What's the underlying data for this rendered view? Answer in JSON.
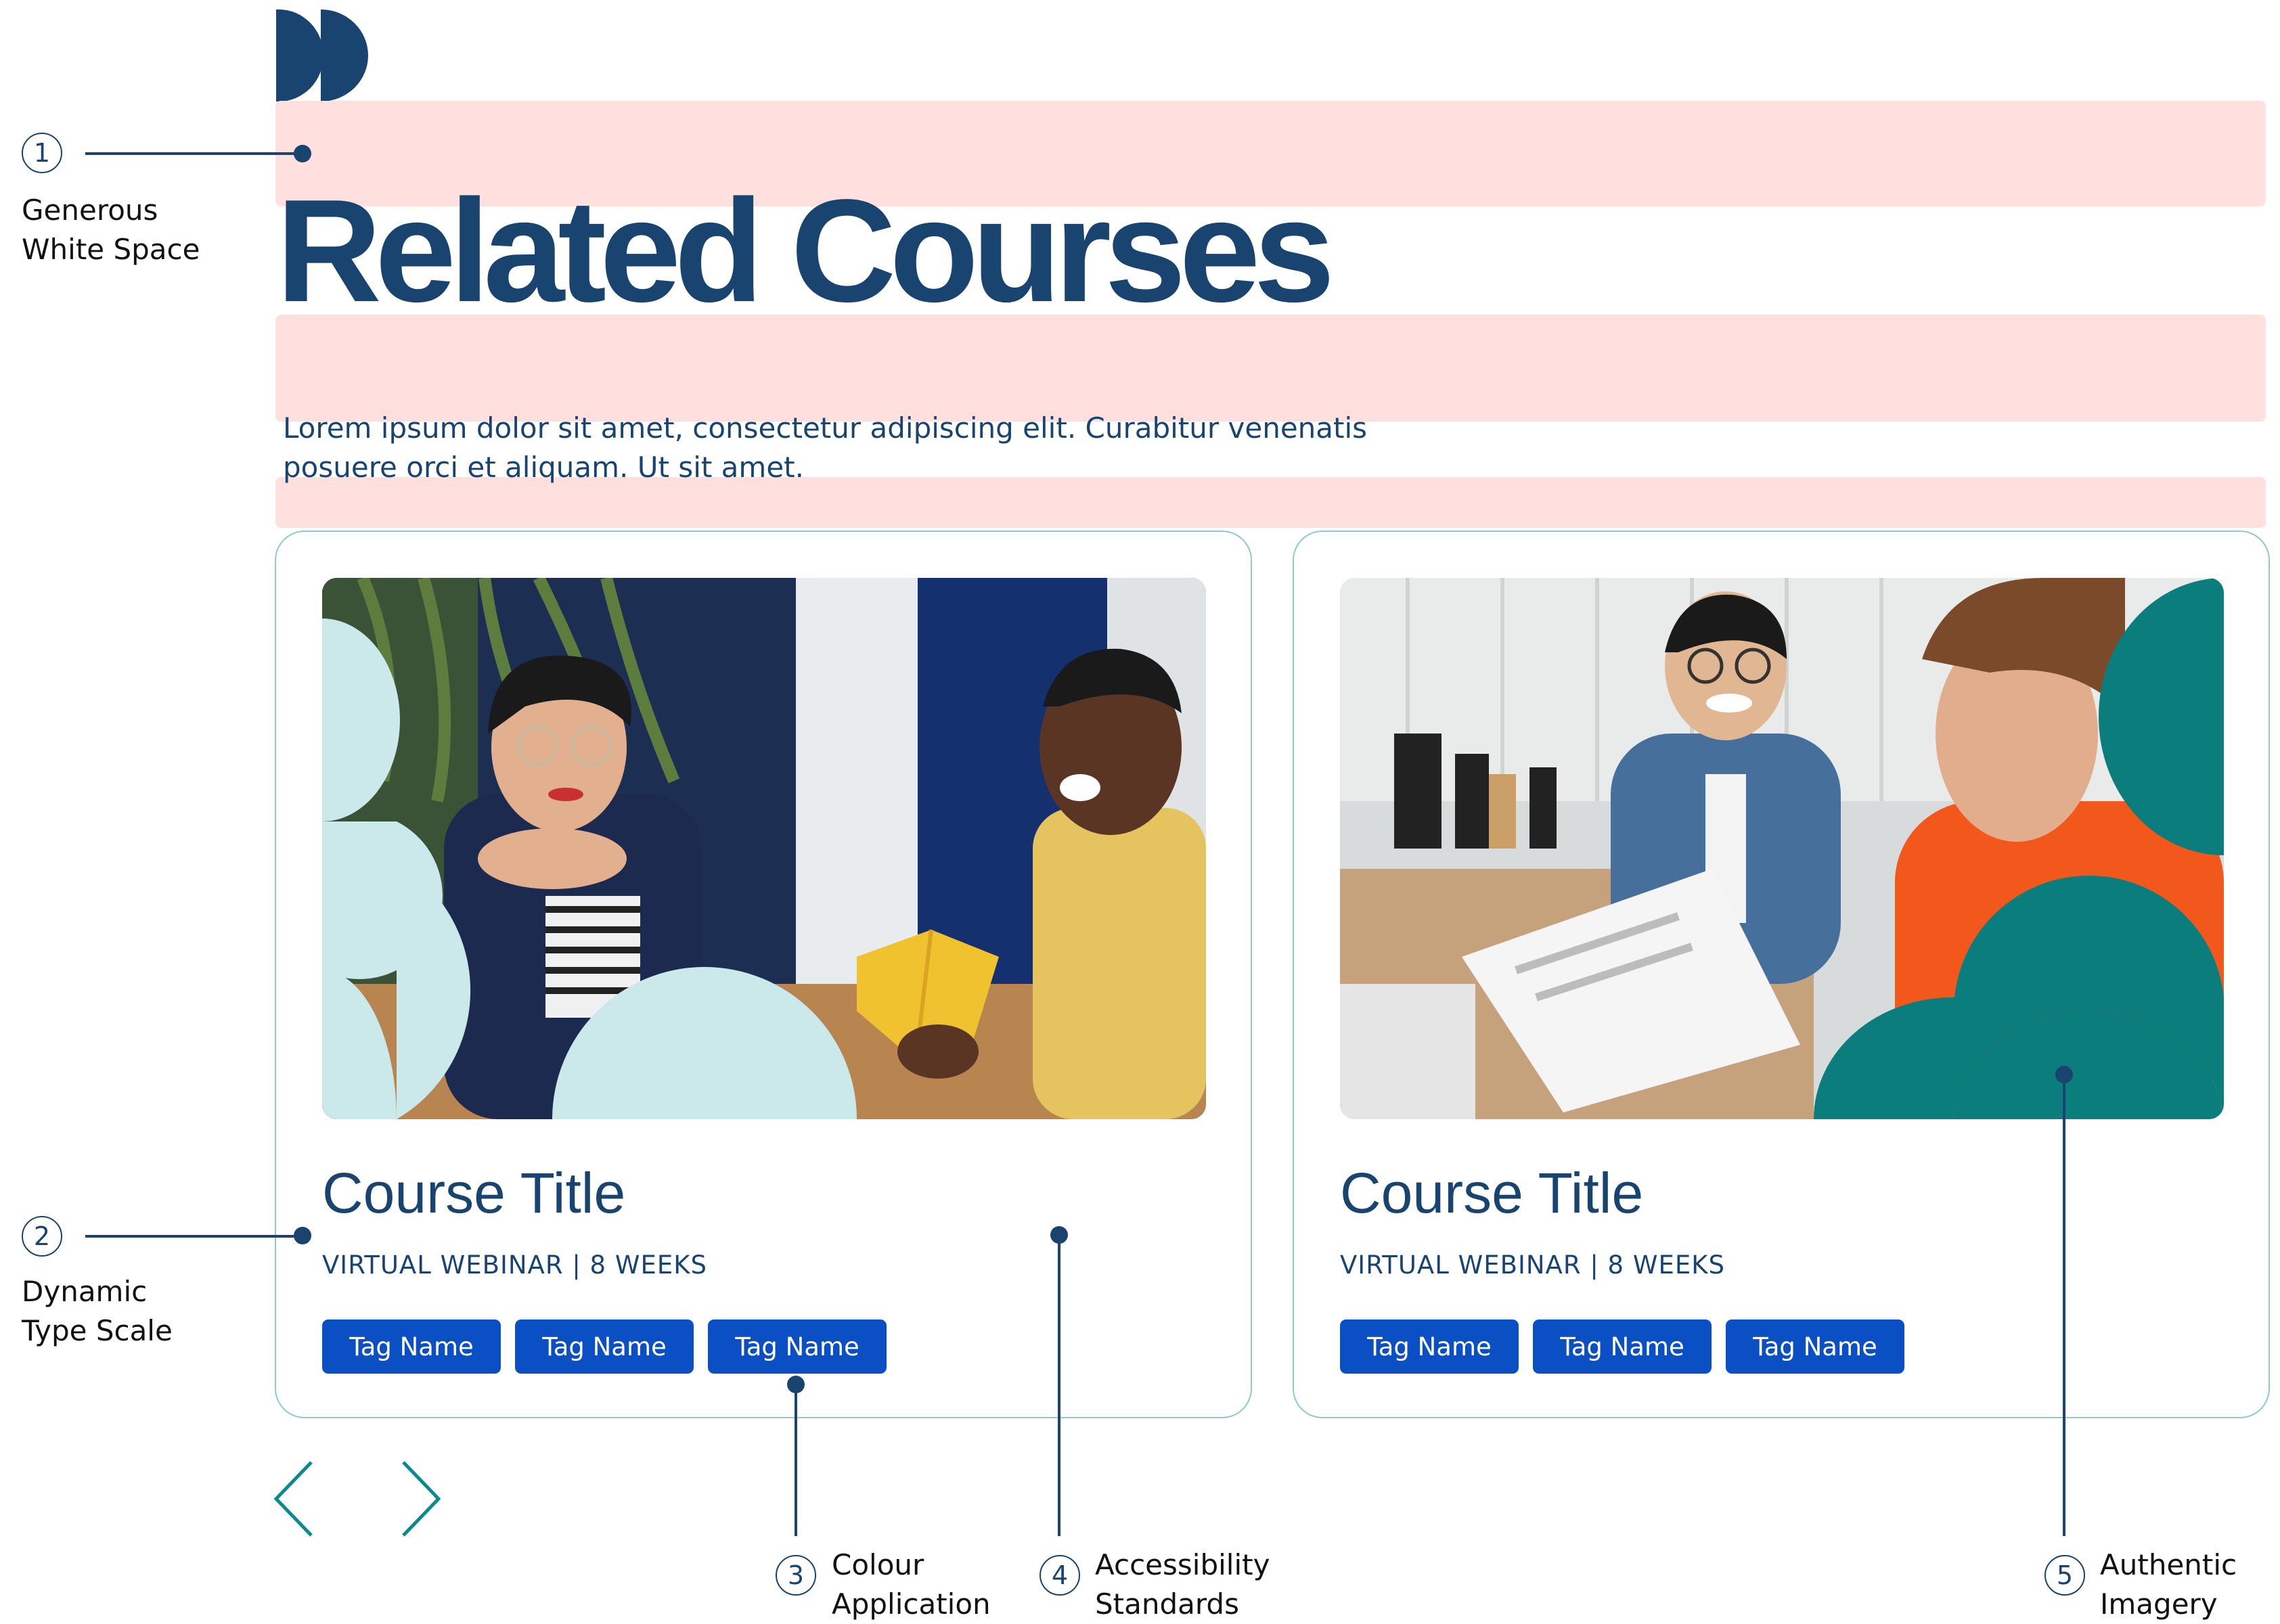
{
  "page": {
    "title": "Related Courses",
    "intro_line1": "Lorem ipsum dolor sit amet, consectetur adipiscing elit. Curabitur venenatis",
    "intro_line2": "posuere orci et aliquam. Ut sit amet."
  },
  "colors": {
    "navy": "#1a4470",
    "tag_blue": "#0a4fc4",
    "teal": "#0b7d7c",
    "light_teal": "#cbe8ea",
    "highlight": "#ffe0de"
  },
  "cards": [
    {
      "title": "Course Title",
      "meta": "VIRTUAL WEBINAR | 8 WEEKS",
      "tags": [
        "Tag Name",
        "Tag Name",
        "Tag Name"
      ],
      "image": "photo-two-people-talking"
    },
    {
      "title": "Course Title",
      "meta": "VIRTUAL WEBINAR | 8 WEEKS",
      "tags": [
        "Tag Name",
        "Tag Name",
        "Tag Name"
      ],
      "image": "photo-office-workers"
    }
  ],
  "carousel": {
    "prev_icon": "chevron-left-icon",
    "next_icon": "chevron-right-icon"
  },
  "annotations": [
    {
      "number": "1",
      "line1": "Generous",
      "line2": "White Space"
    },
    {
      "number": "2",
      "line1": "Dynamic",
      "line2": "Type Scale"
    },
    {
      "number": "3",
      "line1": "Colour",
      "line2": "Application"
    },
    {
      "number": "4",
      "line1": "Accessibility",
      "line2": "Standards"
    },
    {
      "number": "5",
      "line1": "Authentic",
      "line2": "Imagery"
    }
  ]
}
